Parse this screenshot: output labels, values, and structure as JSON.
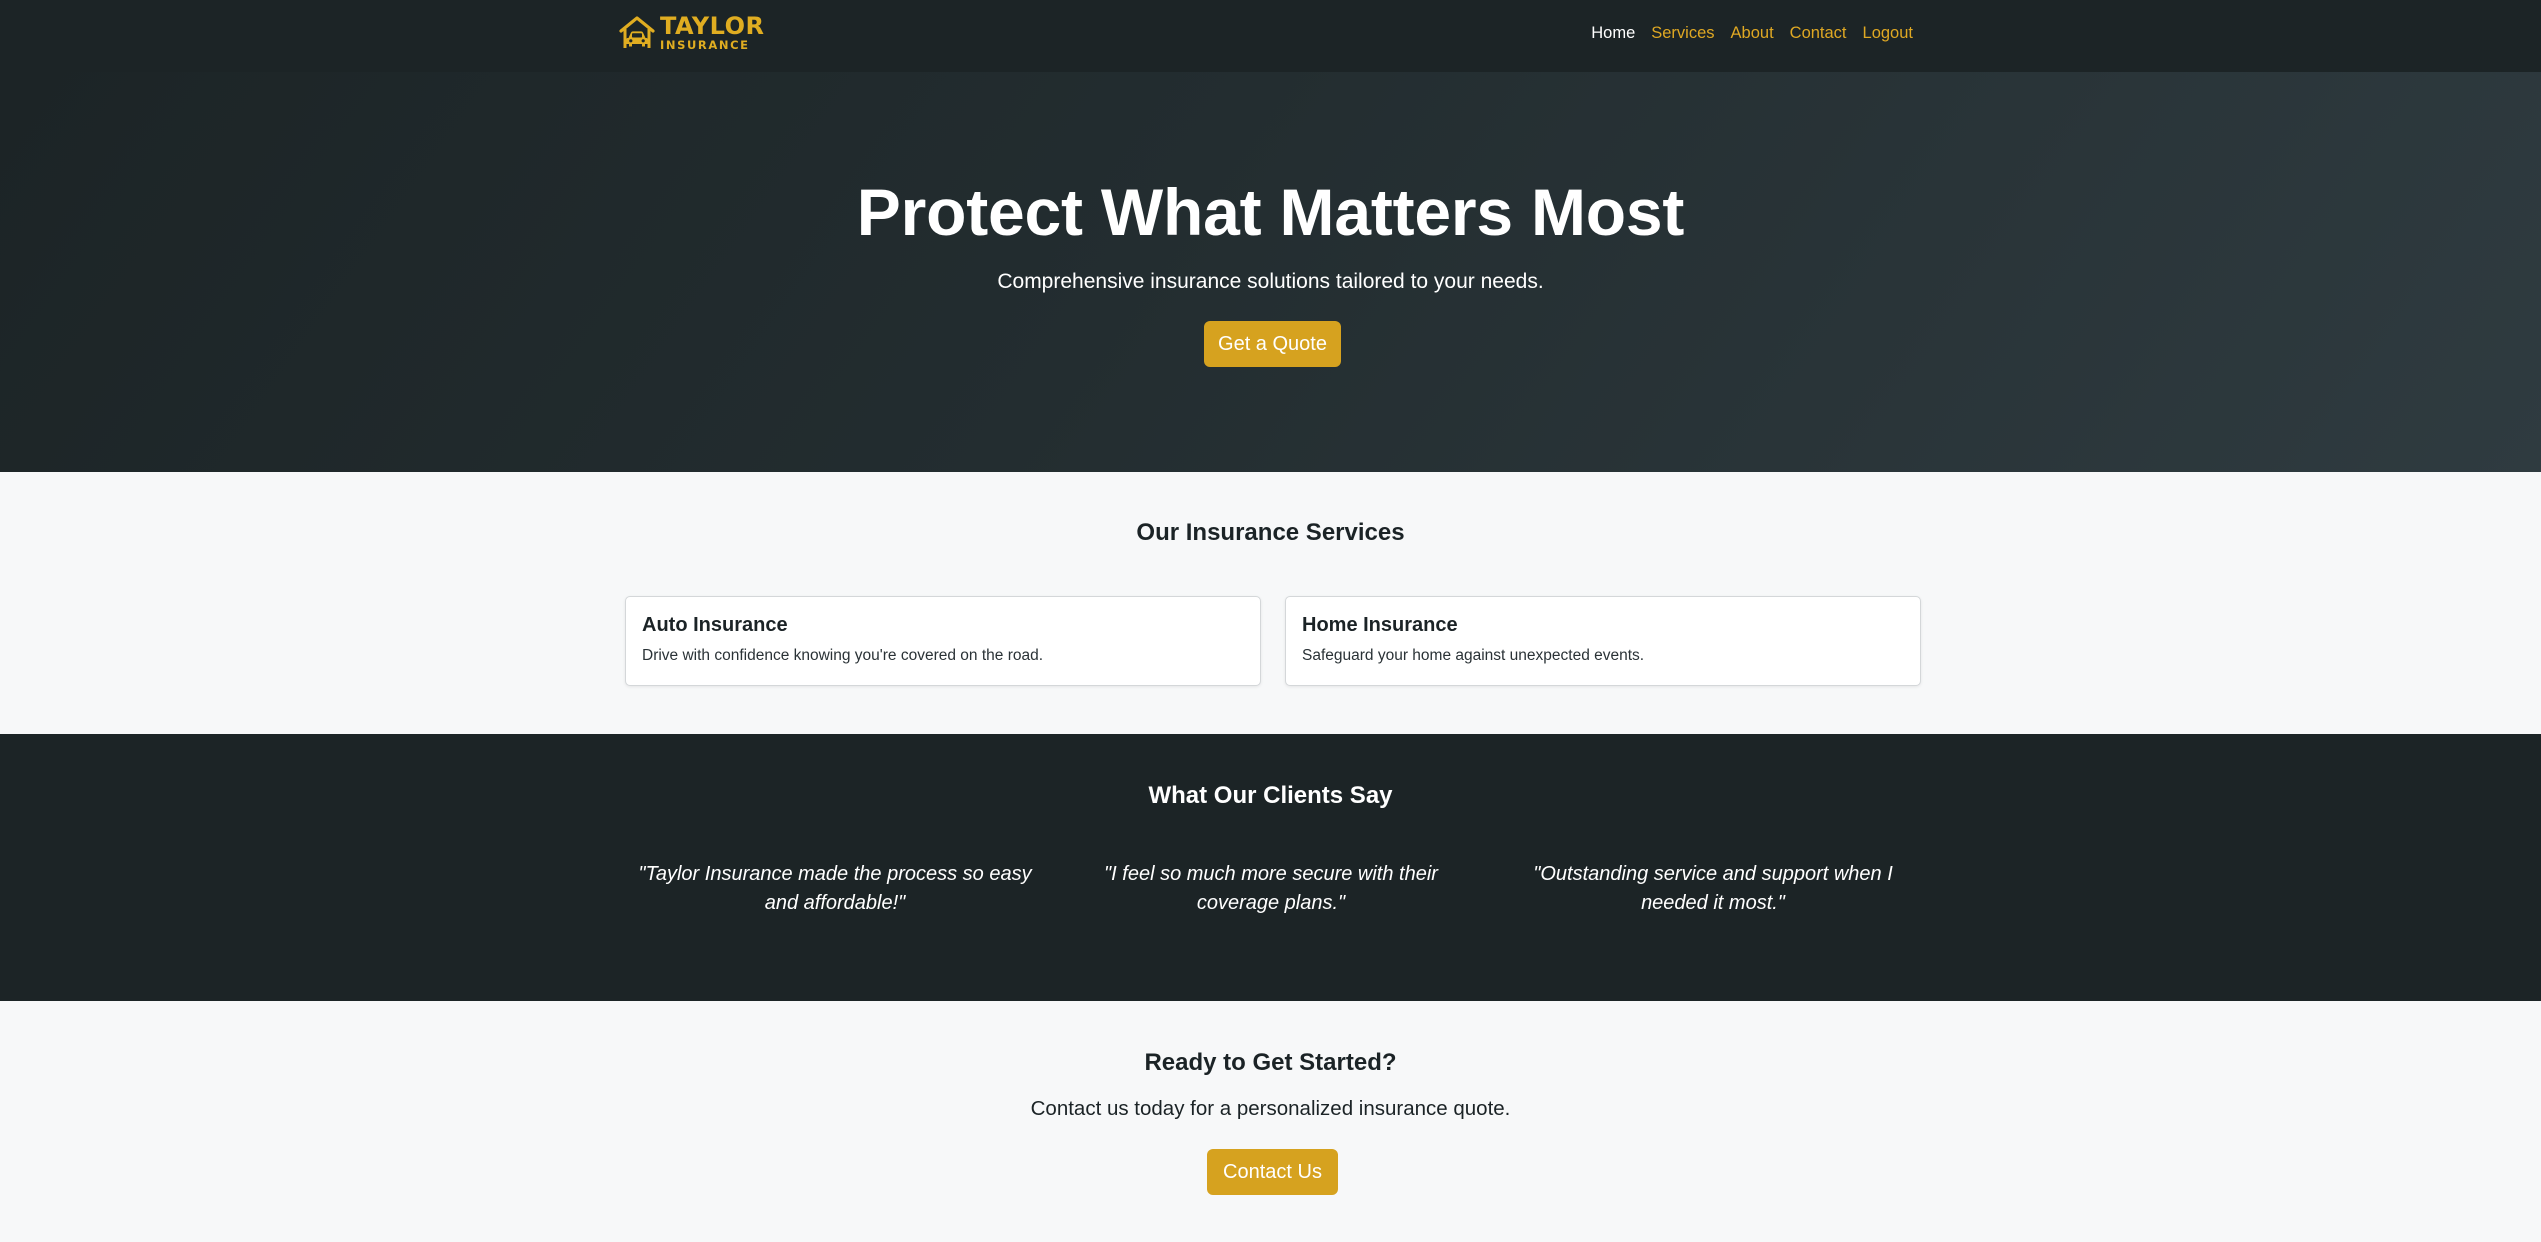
{
  "brand": {
    "line1": "TAYLOR",
    "line2": "INSURANCE",
    "icon": "house-car-icon",
    "color": "#e0ad21"
  },
  "nav": {
    "items": [
      {
        "label": "Home",
        "active": true
      },
      {
        "label": "Services",
        "active": false
      },
      {
        "label": "About",
        "active": false
      },
      {
        "label": "Contact",
        "active": false
      },
      {
        "label": "Logout",
        "active": false
      }
    ]
  },
  "hero": {
    "title": "Protect What Matters Most",
    "subtitle": "Comprehensive insurance solutions tailored to your needs.",
    "button_label": "Get a Quote"
  },
  "services": {
    "title": "Our Insurance Services",
    "cards": [
      {
        "title": "Auto Insurance",
        "text": "Drive with confidence knowing you're covered on the road."
      },
      {
        "title": "Home Insurance",
        "text": "Safeguard your home against unexpected events."
      }
    ]
  },
  "testimonials": {
    "title": "What Our Clients Say",
    "quotes": [
      "\"Taylor Insurance made the process so easy and affordable!\"",
      "\"I feel so much more secure with their coverage plans.\"",
      "\"Outstanding service and support when I needed it most.\""
    ]
  },
  "cta": {
    "title": "Ready to Get Started?",
    "subtitle": "Contact us today for a personalized insurance quote.",
    "button_label": "Contact Us"
  },
  "colors": {
    "dark": "#1c2426",
    "accent": "#d6a21f",
    "light": "#f7f8f9"
  }
}
